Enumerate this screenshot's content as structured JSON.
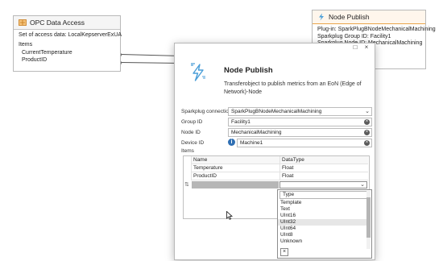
{
  "opc_node": {
    "title": "OPC Data Access",
    "access_label": "Set of access data: LocalKepserverExUA",
    "items_label": "Items",
    "items": [
      "CurrentTemperature",
      "ProductID"
    ]
  },
  "publish_node": {
    "title": "Node Publish",
    "lines": [
      "Plug-in: SparkPlugBNodeMechanicalMachining",
      "Sparkplug Group ID: Facility1",
      "Sparkplug Node ID: MechanicalMachining"
    ]
  },
  "dialog": {
    "title": "Node Publish",
    "description": "Transferobject to publish metrics from an EoN (Edge of Network)-Node",
    "close_glyph": "×",
    "maximize_glyph": "□",
    "fields": {
      "connections_label": "Sparkplug connections",
      "connections_value": "SparkPlugBNodeMechanicalMachining",
      "group_label": "Group ID",
      "group_value": "Facility1",
      "node_label": "Node ID",
      "node_value": "MechanicalMachining",
      "device_label": "Device ID",
      "device_value": "Machine1",
      "items_label": "Items"
    },
    "grid": {
      "col_name": "Name",
      "col_type": "DataType",
      "rows": [
        {
          "name": "Temperature",
          "type": "Float"
        },
        {
          "name": "ProductID",
          "type": "Float"
        }
      ],
      "new_row_marker": "⇅"
    },
    "dropdown": {
      "header": "Type",
      "options": [
        "Template",
        "Text",
        "UInt16",
        "UInt32",
        "UInt64",
        "UInt8",
        "Unknown"
      ],
      "selected": "UInt32"
    }
  },
  "colors": {
    "accent_orange": "#e9a54a",
    "icon_blue": "#4a9ed8",
    "selection": "#e6e6e6",
    "new_row_fill": "#b6b6b6"
  }
}
